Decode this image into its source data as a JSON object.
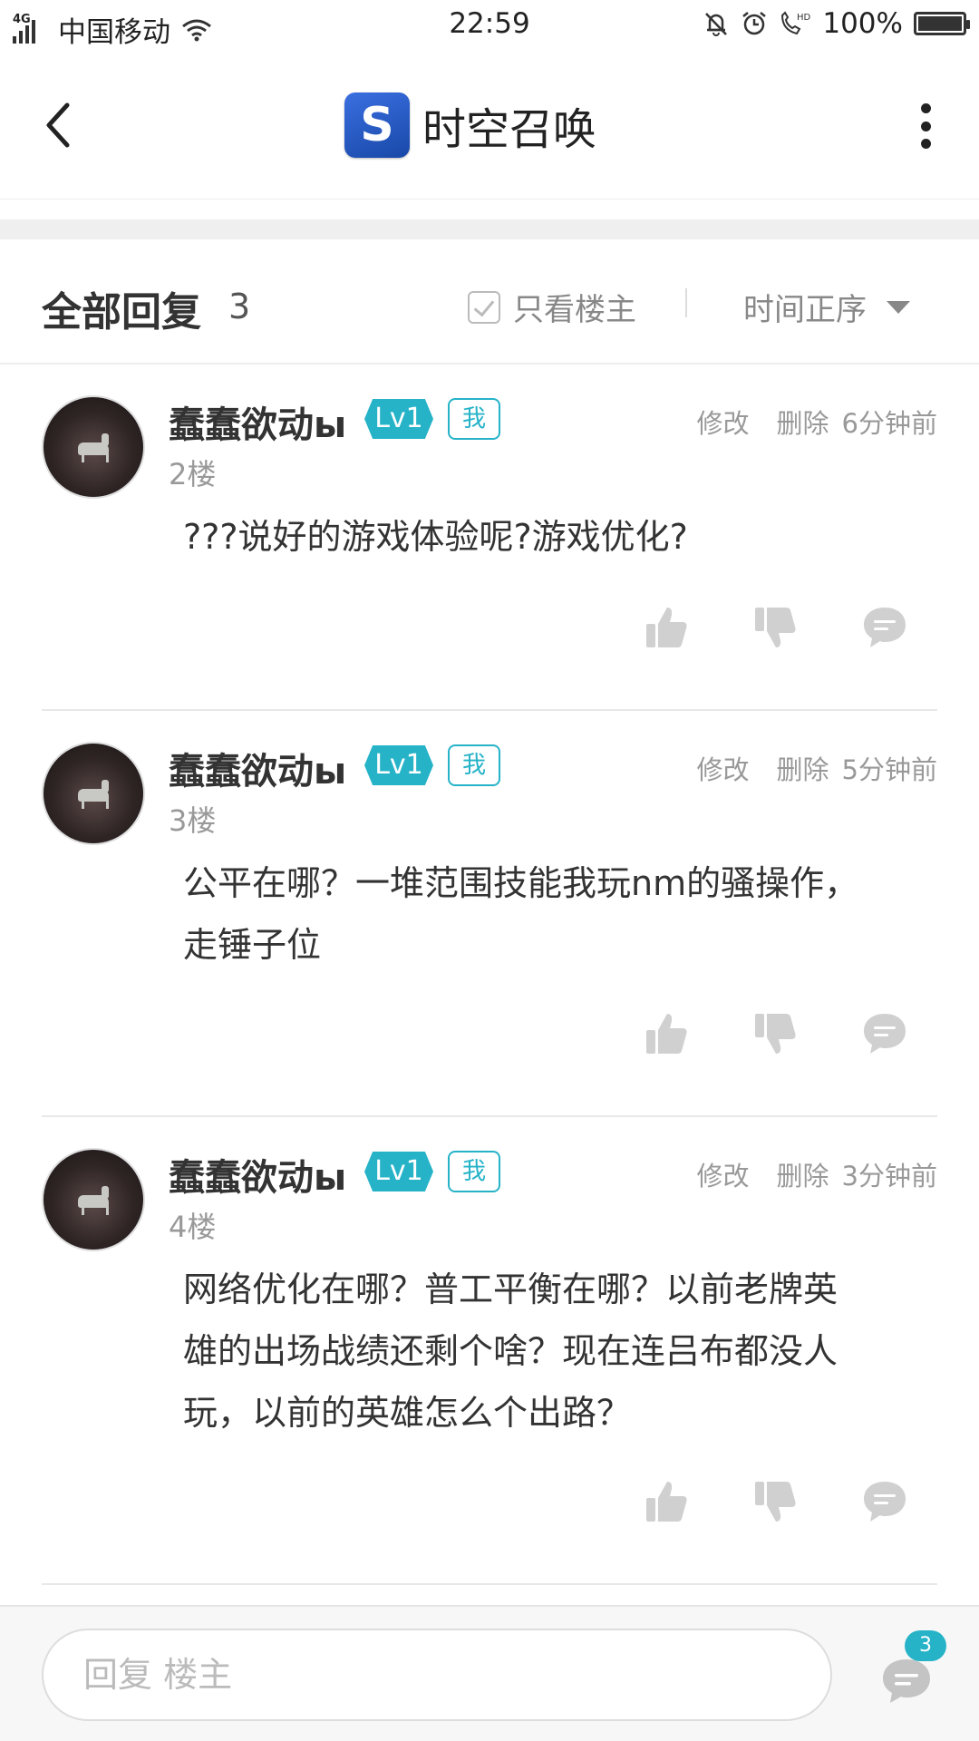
{
  "status_bar": {
    "network": "4G",
    "carrier": "中国移动",
    "time": "22:59",
    "battery": "100%",
    "icons": [
      "signal-icon",
      "wifi-icon",
      "silent-bell-icon",
      "alarm-icon",
      "hd-call-icon",
      "battery-icon"
    ]
  },
  "nav": {
    "title": "时空召唤",
    "logo_letter": "S",
    "icons": [
      "back-arrow-icon",
      "app-logo-icon",
      "more-vertical-icon"
    ]
  },
  "replies_header": {
    "title": "全部回复",
    "count": "3",
    "only_owner": "只看楼主",
    "sort": "时间正序"
  },
  "comments": [
    {
      "username": "蠢蠢欲动ы",
      "level": "Lv1",
      "me": "我",
      "edit": "修改",
      "delete": "删除",
      "time": "6分钟前",
      "floor": "2楼",
      "lines": [
        "???说好的游戏体验呢?游戏优化?"
      ]
    },
    {
      "username": "蠢蠢欲动ы",
      "level": "Lv1",
      "me": "我",
      "edit": "修改",
      "delete": "删除",
      "time": "5分钟前",
      "floor": "3楼",
      "lines": [
        "公平在哪？一堆范围技能我玩nm的骚操作，",
        "走锤子位"
      ]
    },
    {
      "username": "蠢蠢欲动ы",
      "level": "Lv1",
      "me": "我",
      "edit": "修改",
      "delete": "删除",
      "time": "3分钟前",
      "floor": "4楼",
      "lines": [
        "网络优化在哪？普工平衡在哪？以前老牌英",
        "雄的出场战绩还剩个啥？现在连吕布都没人",
        "玩，以前的英雄怎么个出路？"
      ]
    }
  ],
  "bottom_bar": {
    "placeholder": "回复  楼主",
    "badge": "3"
  },
  "colors": {
    "accent": "#26b3c8",
    "text": "#333333",
    "muted": "#999999",
    "icon_gray": "#d0d0d0"
  }
}
